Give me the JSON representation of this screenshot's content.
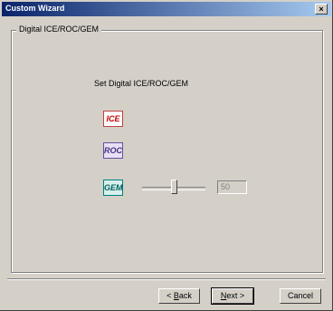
{
  "window": {
    "title": "Custom Wizard",
    "close_glyph": "×"
  },
  "group": {
    "label": "Digital ICE/ROC/GEM"
  },
  "option_heading": "Set Digital ICE/ROC/GEM",
  "icons": {
    "ice": {
      "text": "ICE",
      "name": "ice-icon",
      "color": "#c00000"
    },
    "roc": {
      "text": "ROC",
      "name": "roc-icon",
      "color": "#4b2e83"
    },
    "gem": {
      "text": "GEM",
      "name": "gem-icon",
      "color": "#006060"
    }
  },
  "gem_slider": {
    "value": "50",
    "level_fraction": 0.5
  },
  "buttons": {
    "back_prefix": "< ",
    "back_accel": "B",
    "back_rest": "ack",
    "next_accel": "N",
    "next_rest": "ext >",
    "cancel": "Cancel"
  }
}
